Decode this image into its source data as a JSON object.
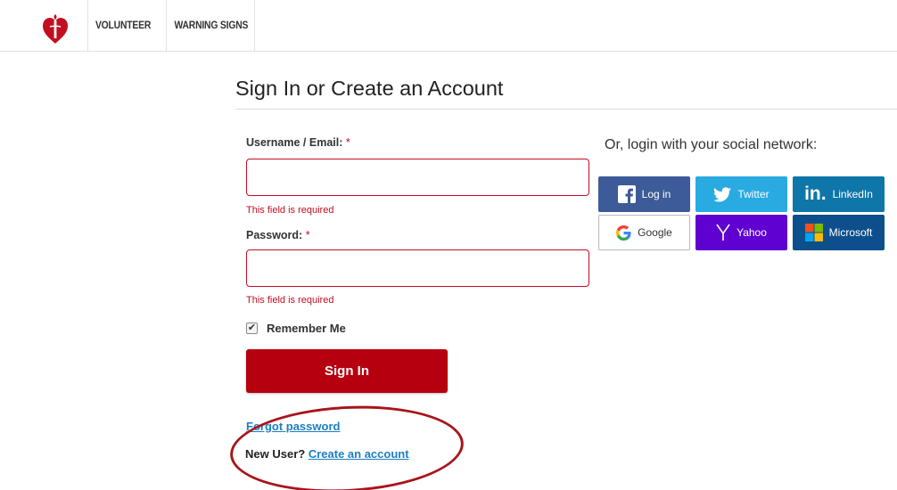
{
  "nav": {
    "items": [
      "VOLUNTEER",
      "WARNING SIGNS"
    ]
  },
  "page": {
    "title": "Sign In or Create an Account"
  },
  "form": {
    "username_label": "Username / Email:",
    "password_label": "Password:",
    "required_mark": "*",
    "username_value": "",
    "password_value": "",
    "username_error": "This field is required",
    "password_error": "This field is required",
    "remember_label": "Remember Me",
    "remember_checked": true,
    "checkmark": "✔",
    "signin_label": "Sign In",
    "forgot_label": "Forgot password",
    "new_user_label": "New User?",
    "create_account_label": "Create an account"
  },
  "social": {
    "heading": "Or, login with your social network:",
    "buttons": [
      {
        "label": "Log in",
        "icon": "facebook-icon",
        "color": "#3c5b98"
      },
      {
        "label": "Twitter",
        "icon": "twitter-icon",
        "color": "#29aae1"
      },
      {
        "label": "LinkedIn",
        "icon": "linkedin-icon",
        "color": "#0e76a8"
      },
      {
        "label": "Google",
        "icon": "google-icon",
        "color": "#ffffff"
      },
      {
        "label": "Yahoo",
        "icon": "yahoo-icon",
        "color": "#5f01d1"
      },
      {
        "label": "Microsoft",
        "icon": "microsoft-icon",
        "color": "#0d4f8c"
      }
    ]
  },
  "colors": {
    "brand_red": "#c10e21",
    "signin_button": "#b7000f",
    "link_blue": "#1b7fc2",
    "annotation_circle": "#a8141a"
  }
}
